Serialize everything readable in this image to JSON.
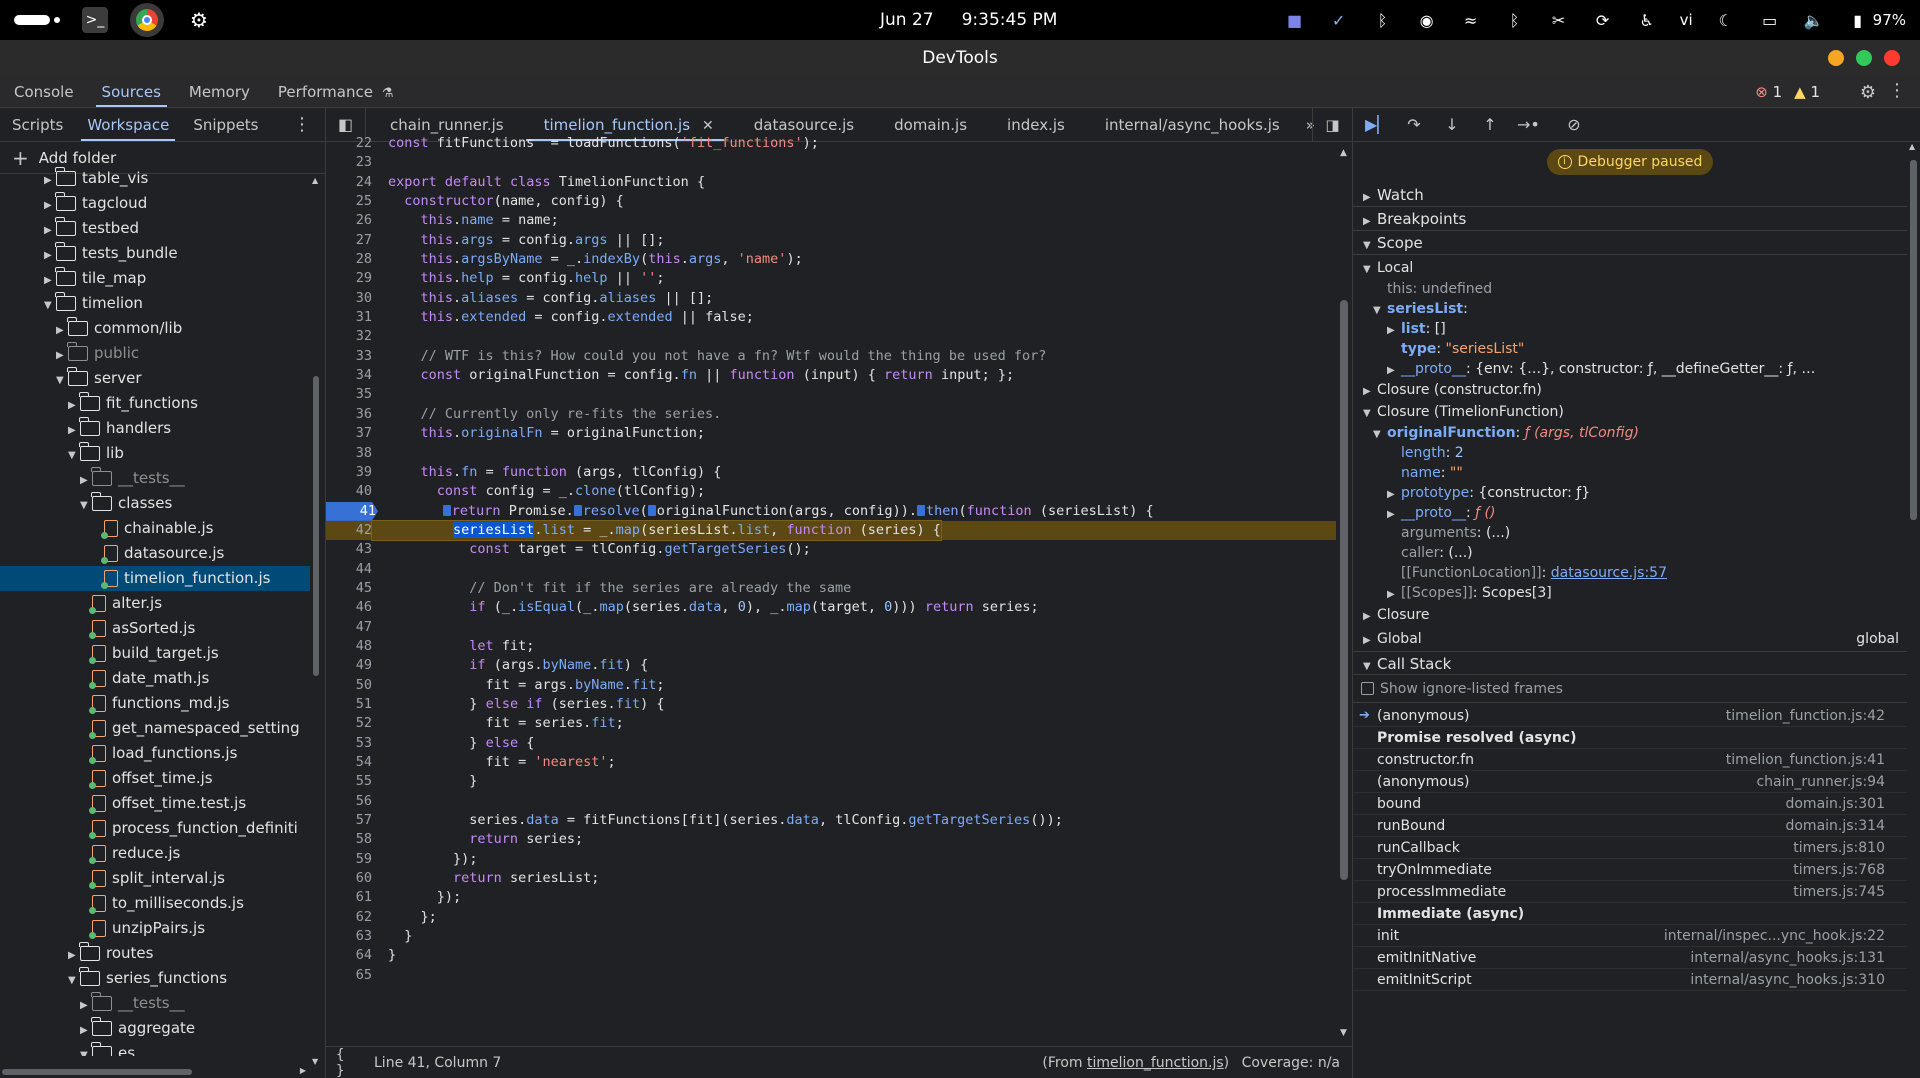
{
  "os_bar": {
    "date": "Jun 27",
    "time": "9:35:45 PM",
    "keyboard_layout": "vi",
    "battery": "97%",
    "tray_icons": [
      "teams-icon",
      "check-circle-icon",
      "bluetooth-icon",
      "discord-icon",
      "wave-icon",
      "bluetooth-icon",
      "tools-icon",
      "sync-icon",
      "accessibility-icon",
      "moon-icon",
      "display-icon",
      "volume-icon",
      "battery-icon"
    ]
  },
  "window": {
    "title": "DevTools",
    "controls": {
      "minimize_color": "#f5a623",
      "maximize_color": "#34c759",
      "close_color": "#ff3b30"
    }
  },
  "main_tabs": [
    "Console",
    "Sources",
    "Memory",
    "Performance"
  ],
  "main_tab_active": "Sources",
  "issues": {
    "errors": "1",
    "warnings": "1"
  },
  "navigator": {
    "tabs": [
      "Scripts",
      "Workspace",
      "Snippets"
    ],
    "active_tab": "Workspace",
    "add_folder_label": "Add folder",
    "tree": [
      {
        "label": "table_vis",
        "type": "folder",
        "depth": 2,
        "expanded": false,
        "dim": false
      },
      {
        "label": "tagcloud",
        "type": "folder",
        "depth": 2,
        "expanded": false,
        "dim": false
      },
      {
        "label": "testbed",
        "type": "folder",
        "depth": 2,
        "expanded": false,
        "dim": false
      },
      {
        "label": "tests_bundle",
        "type": "folder",
        "depth": 2,
        "expanded": false,
        "dim": false
      },
      {
        "label": "tile_map",
        "type": "folder",
        "depth": 2,
        "expanded": false,
        "dim": false
      },
      {
        "label": "timelion",
        "type": "folder",
        "depth": 2,
        "expanded": true,
        "dim": false
      },
      {
        "label": "common/lib",
        "type": "folder",
        "depth": 3,
        "expanded": false,
        "dim": false
      },
      {
        "label": "public",
        "type": "folder",
        "depth": 3,
        "expanded": false,
        "dim": true
      },
      {
        "label": "server",
        "type": "folder",
        "depth": 3,
        "expanded": true,
        "dim": false
      },
      {
        "label": "fit_functions",
        "type": "folder",
        "depth": 4,
        "expanded": false,
        "dim": false
      },
      {
        "label": "handlers",
        "type": "folder",
        "depth": 4,
        "expanded": false,
        "dim": false
      },
      {
        "label": "lib",
        "type": "folder",
        "depth": 4,
        "expanded": true,
        "dim": false
      },
      {
        "label": "__tests__",
        "type": "folder",
        "depth": 5,
        "expanded": false,
        "dim": true
      },
      {
        "label": "classes",
        "type": "folder",
        "depth": 5,
        "expanded": true,
        "dim": false
      },
      {
        "label": "chainable.js",
        "type": "file",
        "depth": 6,
        "dim": false
      },
      {
        "label": "datasource.js",
        "type": "file",
        "depth": 6,
        "dim": false
      },
      {
        "label": "timelion_function.js",
        "type": "file",
        "depth": 6,
        "dim": false,
        "selected": true
      },
      {
        "label": "alter.js",
        "type": "file",
        "depth": 5,
        "dim": false
      },
      {
        "label": "asSorted.js",
        "type": "file",
        "depth": 5,
        "dim": false
      },
      {
        "label": "build_target.js",
        "type": "file",
        "depth": 5,
        "dim": false
      },
      {
        "label": "date_math.js",
        "type": "file",
        "depth": 5,
        "dim": false
      },
      {
        "label": "functions_md.js",
        "type": "file",
        "depth": 5,
        "dim": false
      },
      {
        "label": "get_namespaced_setting",
        "type": "file",
        "depth": 5,
        "dim": false
      },
      {
        "label": "load_functions.js",
        "type": "file",
        "depth": 5,
        "dim": false
      },
      {
        "label": "offset_time.js",
        "type": "file",
        "depth": 5,
        "dim": false
      },
      {
        "label": "offset_time.test.js",
        "type": "file",
        "depth": 5,
        "dim": false
      },
      {
        "label": "process_function_definiti",
        "type": "file",
        "depth": 5,
        "dim": false
      },
      {
        "label": "reduce.js",
        "type": "file",
        "depth": 5,
        "dim": false
      },
      {
        "label": "split_interval.js",
        "type": "file",
        "depth": 5,
        "dim": false
      },
      {
        "label": "to_milliseconds.js",
        "type": "file",
        "depth": 5,
        "dim": false
      },
      {
        "label": "unzipPairs.js",
        "type": "file",
        "depth": 5,
        "dim": false
      },
      {
        "label": "routes",
        "type": "folder",
        "depth": 4,
        "expanded": false,
        "dim": false
      },
      {
        "label": "series_functions",
        "type": "folder",
        "depth": 4,
        "expanded": true,
        "dim": false
      },
      {
        "label": "__tests__",
        "type": "folder",
        "depth": 5,
        "expanded": false,
        "dim": true
      },
      {
        "label": "aggregate",
        "type": "folder",
        "depth": 5,
        "expanded": false,
        "dim": false
      },
      {
        "label": "es",
        "type": "folder",
        "depth": 5,
        "expanded": true,
        "dim": false
      }
    ]
  },
  "editor": {
    "tabs": [
      {
        "label": "chain_runner.js",
        "active": false,
        "closable": false
      },
      {
        "label": "timelion_function.js",
        "active": true,
        "closable": true
      },
      {
        "label": "datasource.js",
        "active": false,
        "closable": false
      },
      {
        "label": "domain.js",
        "active": false,
        "closable": false
      },
      {
        "label": "index.js",
        "active": false,
        "closable": false
      },
      {
        "label": "internal/async_hooks.js",
        "active": false,
        "closable": false
      }
    ],
    "breakpoint_line": "41",
    "execution_line": "42",
    "lines": [
      {
        "n": "22",
        "code": "const fitFunctions  = loadFunctions('fit_functions');"
      },
      {
        "n": "23",
        "code": ""
      },
      {
        "n": "24",
        "code": "export default class TimelionFunction {"
      },
      {
        "n": "25",
        "code": "  constructor(name, config) {"
      },
      {
        "n": "26",
        "code": "    this.name = name;"
      },
      {
        "n": "27",
        "code": "    this.args = config.args || [];"
      },
      {
        "n": "28",
        "code": "    this.argsByName = _.indexBy(this.args, 'name');"
      },
      {
        "n": "29",
        "code": "    this.help = config.help || '';"
      },
      {
        "n": "30",
        "code": "    this.aliases = config.aliases || [];"
      },
      {
        "n": "31",
        "code": "    this.extended = config.extended || false;"
      },
      {
        "n": "32",
        "code": ""
      },
      {
        "n": "33",
        "code": "    // WTF is this? How could you not have a fn? Wtf would the thing be used for?"
      },
      {
        "n": "34",
        "code": "    const originalFunction = config.fn || function (input) { return input; };"
      },
      {
        "n": "35",
        "code": ""
      },
      {
        "n": "36",
        "code": "    // Currently only re-fits the series."
      },
      {
        "n": "37",
        "code": "    this.originalFn = originalFunction;"
      },
      {
        "n": "38",
        "code": ""
      },
      {
        "n": "39",
        "code": "    this.fn = function (args, tlConfig) {"
      },
      {
        "n": "40",
        "code": "      const config = _.clone(tlConfig);"
      },
      {
        "n": "41",
        "code": "      return Promise.resolve(originalFunction(args, config)).then(function (seriesList) {"
      },
      {
        "n": "42",
        "code": "        seriesList.list = _.map(seriesList.list, function (series) {"
      },
      {
        "n": "43",
        "code": "          const target = tlConfig.getTargetSeries();"
      },
      {
        "n": "44",
        "code": ""
      },
      {
        "n": "45",
        "code": "          // Don't fit if the series are already the same"
      },
      {
        "n": "46",
        "code": "          if (_.isEqual(_.map(series.data, 0), _.map(target, 0))) return series;"
      },
      {
        "n": "47",
        "code": ""
      },
      {
        "n": "48",
        "code": "          let fit;"
      },
      {
        "n": "49",
        "code": "          if (args.byName.fit) {"
      },
      {
        "n": "50",
        "code": "            fit = args.byName.fit;"
      },
      {
        "n": "51",
        "code": "          } else if (series.fit) {"
      },
      {
        "n": "52",
        "code": "            fit = series.fit;"
      },
      {
        "n": "53",
        "code": "          } else {"
      },
      {
        "n": "54",
        "code": "            fit = 'nearest';"
      },
      {
        "n": "55",
        "code": "          }"
      },
      {
        "n": "56",
        "code": ""
      },
      {
        "n": "57",
        "code": "          series.data = fitFunctions[fit](series.data, tlConfig.getTargetSeries());"
      },
      {
        "n": "58",
        "code": "          return series;"
      },
      {
        "n": "59",
        "code": "        });"
      },
      {
        "n": "60",
        "code": "        return seriesList;"
      },
      {
        "n": "61",
        "code": "      });"
      },
      {
        "n": "62",
        "code": "    };"
      },
      {
        "n": "63",
        "code": "  }"
      },
      {
        "n": "64",
        "code": "}"
      },
      {
        "n": "65",
        "code": ""
      }
    ],
    "status": {
      "pretty_print": "{ }",
      "cursor": "Line 41, Column 7",
      "from_prefix": "(From ",
      "from_file": "timelion_function.js",
      "from_suffix": ")",
      "coverage": "Coverage: n/a"
    }
  },
  "debugger": {
    "paused_label": "Debugger paused",
    "sections": {
      "watch": "Watch",
      "breakpoints": "Breakpoints",
      "scope": "Scope",
      "call_stack": "Call Stack"
    },
    "scope": {
      "local_label": "Local",
      "this_key": "this",
      "this_value": "undefined",
      "seriesList_key": "seriesList",
      "list_key": "list",
      "list_value": "[]",
      "type_key": "type",
      "type_value": "\"seriesList\"",
      "proto_key": "__proto__",
      "proto_value": "{env: {…}, constructor: ƒ, __defineGetter__: ƒ, …",
      "closure_ctor": "Closure (constructor.fn)",
      "closure_tf": "Closure (TimelionFunction)",
      "orig_key": "originalFunction",
      "orig_value": "ƒ (args, tlConfig)",
      "length_key": "length",
      "length_value": "2",
      "name_key": "name",
      "name_value": "\"\"",
      "prototype_key": "prototype",
      "prototype_value": "{constructor: ƒ}",
      "proto2_key": "__proto__",
      "proto2_value": "ƒ ()",
      "arguments_key": "arguments",
      "arguments_value": "(...)",
      "caller_key": "caller",
      "caller_value": "(...)",
      "fnloc_key": "[[FunctionLocation]]",
      "fnloc_value": "datasource.js:57",
      "scopes_key": "[[Scopes]]",
      "scopes_value": "Scopes[3]",
      "closure_label": "Closure",
      "global_label": "Global",
      "global_value": "global"
    },
    "show_ignore_label": "Show ignore-listed frames",
    "call_stack": [
      {
        "kind": "frame",
        "name": "(anonymous)",
        "loc": "timelion_function.js:42",
        "current": true
      },
      {
        "kind": "async",
        "name": "Promise resolved (async)"
      },
      {
        "kind": "frame",
        "name": "constructor.fn",
        "loc": "timelion_function.js:41"
      },
      {
        "kind": "frame",
        "name": "(anonymous)",
        "loc": "chain_runner.js:94"
      },
      {
        "kind": "frame",
        "name": "bound",
        "loc": "domain.js:301"
      },
      {
        "kind": "frame",
        "name": "runBound",
        "loc": "domain.js:314"
      },
      {
        "kind": "frame",
        "name": "runCallback",
        "loc": "timers.js:810"
      },
      {
        "kind": "frame",
        "name": "tryOnImmediate",
        "loc": "timers.js:768"
      },
      {
        "kind": "frame",
        "name": "processImmediate",
        "loc": "timers.js:745"
      },
      {
        "kind": "async",
        "name": "Immediate (async)"
      },
      {
        "kind": "frame",
        "name": "init",
        "loc": "internal/inspec...ync_hook.js:22"
      },
      {
        "kind": "frame",
        "name": "emitInitNative",
        "loc": "internal/async_hooks.js:131"
      },
      {
        "kind": "frame",
        "name": "emitInitScript",
        "loc": "internal/async_hooks.js:310"
      }
    ]
  }
}
